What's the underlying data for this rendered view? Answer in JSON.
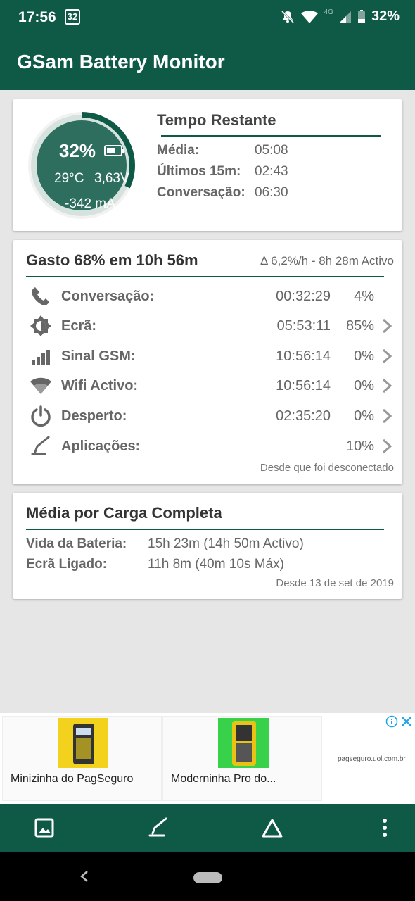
{
  "status_bar": {
    "time": "17:56",
    "notification_badge": "32",
    "battery_percent": "32%",
    "network_type": "4G",
    "icons": [
      "mute-icon",
      "wifi-icon",
      "signal-icon",
      "battery-icon"
    ]
  },
  "app_bar": {
    "title": "GSam Battery Monitor"
  },
  "battery_gauge": {
    "percent": "32%",
    "level": 0.32,
    "temperature": "29°C",
    "voltage": "3,63V",
    "current": "-342 mA"
  },
  "time_remaining": {
    "title": "Tempo Restante",
    "rows": [
      {
        "label": "Média:",
        "value": "05:08"
      },
      {
        "label": "Últimos 15m:",
        "value": "02:43"
      },
      {
        "label": "Conversação:",
        "value": "06:30"
      }
    ]
  },
  "usage": {
    "title": "Gasto 68% em 10h 56m",
    "rate": "Δ 6,2%/h - 8h 28m Activo",
    "rows": [
      {
        "icon": "phone-icon",
        "label": "Conversação:",
        "time": "00:32:29",
        "percent": "4%",
        "chevron": false
      },
      {
        "icon": "brightness-icon",
        "label": "Ecrã:",
        "time": "05:53:11",
        "percent": "85%",
        "chevron": true
      },
      {
        "icon": "signal-bars-icon",
        "label": "Sinal GSM:",
        "time": "10:56:14",
        "percent": "0%",
        "chevron": true
      },
      {
        "icon": "wifi-icon",
        "label": "Wifi Activo:",
        "time": "10:56:14",
        "percent": "0%",
        "chevron": true
      },
      {
        "icon": "power-icon",
        "label": "Desperto:",
        "time": "02:35:20",
        "percent": "0%",
        "chevron": true
      },
      {
        "icon": "apps-icon",
        "label": "Aplicações:",
        "time": "",
        "percent": "10%",
        "chevron": true
      }
    ],
    "footer": "Desde que foi desconectado"
  },
  "full_charge": {
    "title": "Média por Carga Completa",
    "rows": [
      {
        "label": "Vida da Bateria:",
        "value": "15h 23m (14h 50m Activo)"
      },
      {
        "label": "Ecrã Ligado:",
        "value": "11h 8m (40m 10s Máx)"
      }
    ],
    "footer": "Desde 13 de set de 2019"
  },
  "ad": {
    "items": [
      {
        "text": "Minizinha do PagSeguro"
      },
      {
        "text": "Moderninha Pro do..."
      }
    ],
    "domain": "pagseguro.uol.com.br"
  },
  "bottom_bar": {
    "buttons": [
      "image-icon",
      "apps-icon",
      "triangle-icon",
      "more-vert-icon"
    ]
  },
  "colors": {
    "primary": "#0e5a47",
    "gauge_fill": "#2e6e5e",
    "background": "#e6e6e6"
  }
}
